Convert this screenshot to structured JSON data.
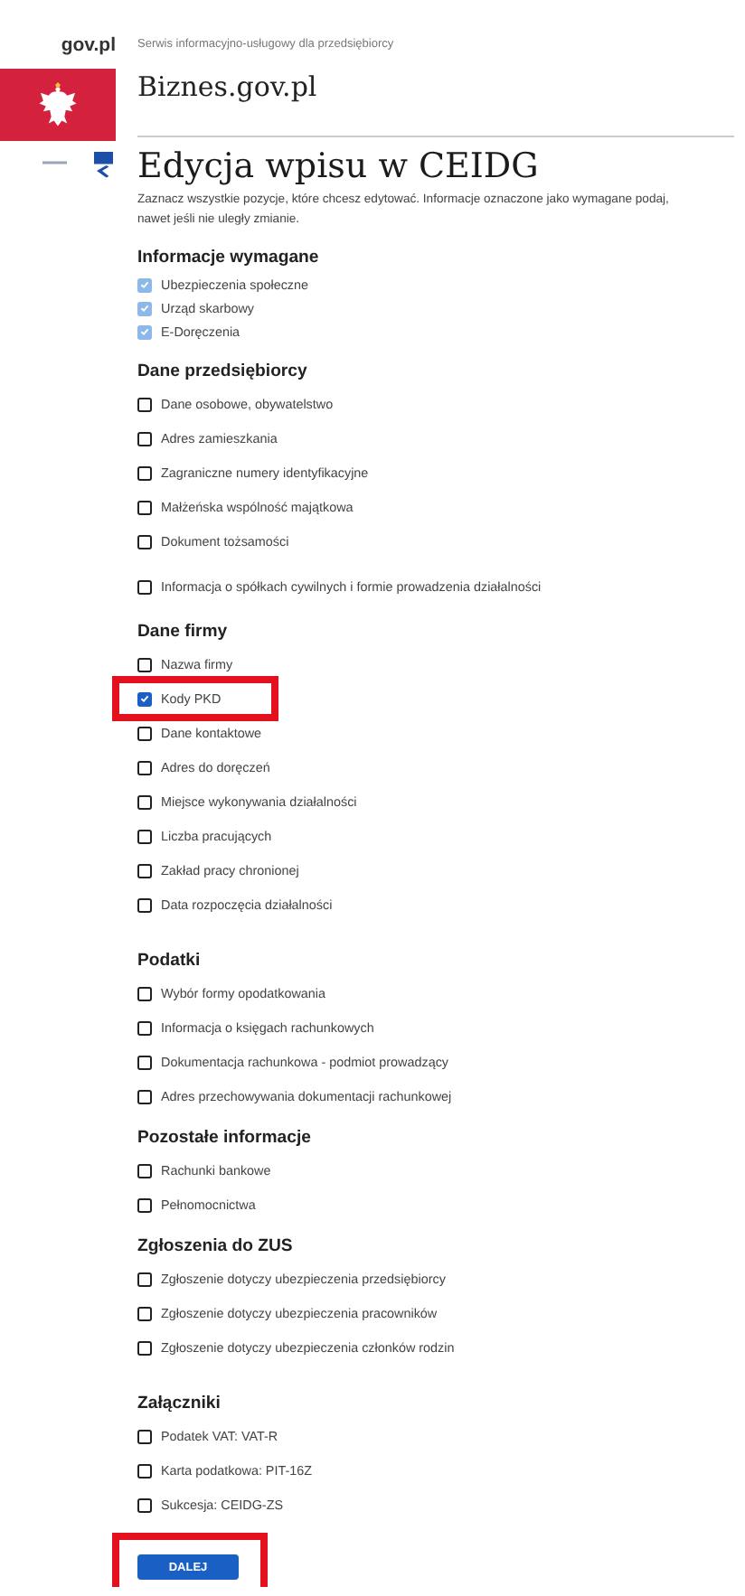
{
  "header": {
    "gov_label": "gov.pl",
    "tagline": "Serwis informacyjno-usługowy dla przedsiębiorcy",
    "brand": "Biznes.gov.pl"
  },
  "title": "Edycja wpisu w CEIDG",
  "description": "Zaznacz wszystkie pozycje, które chcesz edytować. Informacje oznaczone jako wymagane podaj, nawet jeśli nie uległy zmianie.",
  "sections": [
    {
      "heading": "Informacje wymagane",
      "kind": "required",
      "items": [
        {
          "label": "Ubezpieczenia społeczne",
          "checked": true,
          "disabled": true
        },
        {
          "label": "Urząd skarbowy",
          "checked": true,
          "disabled": true
        },
        {
          "label": "E-Doręczenia",
          "checked": true,
          "disabled": true
        }
      ]
    },
    {
      "heading": "Dane przedsiębiorcy",
      "kind": "optional",
      "items": [
        {
          "label": "Dane osobowe, obywatelstwo",
          "checked": false,
          "disabled": false
        },
        {
          "label": "Adres zamieszkania",
          "checked": false,
          "disabled": false
        },
        {
          "label": "Zagraniczne numery identyfikacyjne",
          "checked": false,
          "disabled": false
        },
        {
          "label": "Małżeńska wspólność majątkowa",
          "checked": false,
          "disabled": false
        },
        {
          "label": "Dokument tożsamości",
          "checked": false,
          "disabled": false
        },
        {
          "label": "Informacja o spółkach cywilnych i formie prowadzenia działalności",
          "checked": false,
          "disabled": false
        }
      ]
    },
    {
      "heading": "Dane firmy",
      "kind": "optional",
      "items": [
        {
          "label": "Nazwa firmy",
          "checked": false,
          "disabled": false
        },
        {
          "label": "Kody PKD",
          "checked": true,
          "disabled": false,
          "highlighted": true
        },
        {
          "label": "Dane kontaktowe",
          "checked": false,
          "disabled": false
        },
        {
          "label": "Adres do doręczeń",
          "checked": false,
          "disabled": false
        },
        {
          "label": "Miejsce wykonywania działalności",
          "checked": false,
          "disabled": false
        },
        {
          "label": "Liczba pracujących",
          "checked": false,
          "disabled": false
        },
        {
          "label": "Zakład pracy chronionej",
          "checked": false,
          "disabled": false
        },
        {
          "label": "Data rozpoczęcia działalności",
          "checked": false,
          "disabled": false
        }
      ]
    },
    {
      "heading": "Podatki",
      "kind": "optional",
      "items": [
        {
          "label": "Wybór formy opodatkowania",
          "checked": false,
          "disabled": false
        },
        {
          "label": "Informacja o księgach rachunkowych",
          "checked": false,
          "disabled": false
        },
        {
          "label": "Dokumentacja rachunkowa - podmiot prowadzący",
          "checked": false,
          "disabled": false
        },
        {
          "label": "Adres przechowywania dokumentacji rachunkowej",
          "checked": false,
          "disabled": false
        }
      ]
    },
    {
      "heading": "Pozostałe informacje",
      "kind": "optional",
      "items": [
        {
          "label": "Rachunki bankowe",
          "checked": false,
          "disabled": false
        },
        {
          "label": "Pełnomocnictwa",
          "checked": false,
          "disabled": false
        }
      ]
    },
    {
      "heading": "Zgłoszenia do ZUS",
      "kind": "optional",
      "items": [
        {
          "label": "Zgłoszenie dotyczy ubezpieczenia przedsiębiorcy",
          "checked": false,
          "disabled": false
        },
        {
          "label": "Zgłoszenie dotyczy ubezpieczenia pracowników",
          "checked": false,
          "disabled": false
        },
        {
          "label": "Zgłoszenie dotyczy ubezpieczenia członków rodzin",
          "checked": false,
          "disabled": false
        }
      ]
    },
    {
      "heading": "Załączniki",
      "kind": "optional",
      "items": [
        {
          "label": "Podatek VAT: VAT-R",
          "checked": false,
          "disabled": false
        },
        {
          "label": "Karta podatkowa: PIT-16Z",
          "checked": false,
          "disabled": false
        },
        {
          "label": "Sukcesja: CEIDG-ZS",
          "checked": false,
          "disabled": false
        }
      ]
    }
  ],
  "next_button": {
    "label": "DALEJ",
    "highlighted": true
  }
}
